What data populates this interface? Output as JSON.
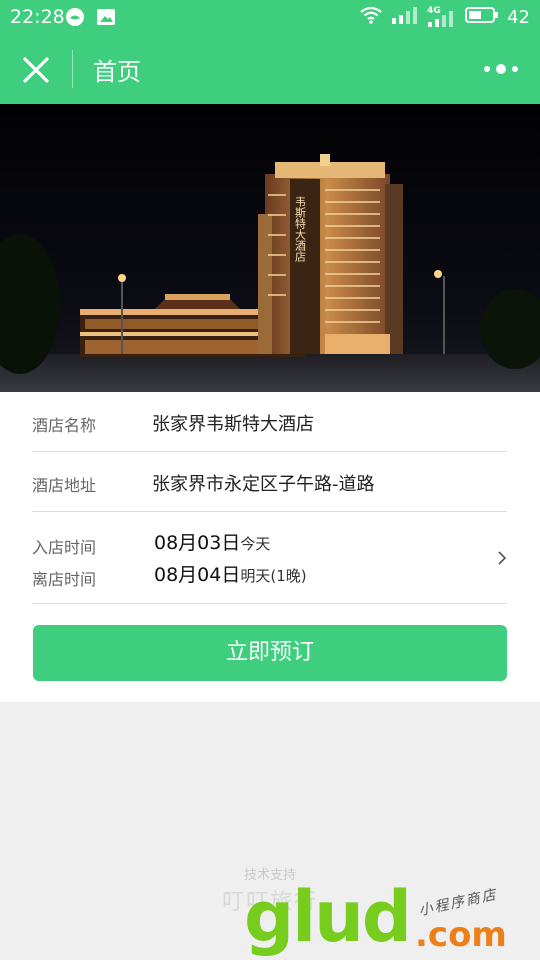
{
  "status_bar": {
    "time": "22:28",
    "network": "4G",
    "battery": "42"
  },
  "navbar": {
    "title": "首页"
  },
  "hotel_image": {
    "sign_text": "韦斯特大酒店"
  },
  "info": {
    "name_label": "酒店名称",
    "name_value": "张家界韦斯特大酒店",
    "address_label": "酒店地址",
    "address_value": "张家界市永定区子午路-道路",
    "checkin_label": "入店时间",
    "checkin_date": "08月03日",
    "checkin_note": "今天",
    "checkout_label": "离店时间",
    "checkout_date": "08月04日",
    "checkout_note": "明天(1晚)"
  },
  "book_button": "立即预订",
  "footer": {
    "support": "技术支持",
    "brand": "叮叮旅行"
  },
  "watermark": {
    "main": "glud",
    "suffix": ".com",
    "tagline": "小程序商店"
  },
  "colors": {
    "accent": "#3fcd7e",
    "watermark_green": "#76cd1e",
    "watermark_orange": "#ee7e18"
  }
}
